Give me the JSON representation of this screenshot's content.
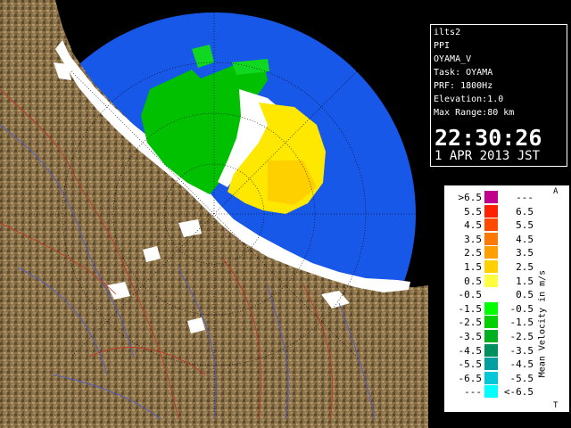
{
  "info": {
    "site": "ilts2",
    "product": "PPI",
    "radar": "OYAMA_V",
    "task": "Task: OYAMA",
    "prf": "PRF: 1800Hz",
    "elevation": "Elevation:1.0",
    "max_range": "Max Range:80 km",
    "time": "22:30:26",
    "date": "1 APR 2013 JST"
  },
  "legend": {
    "title": "Mean Velocity in m/s",
    "corner_top": "A",
    "corner_bottom": "T",
    "rows": [
      {
        "lo": ">6.5",
        "hi": "---",
        "color": "#c0008c"
      },
      {
        "lo": "5.5",
        "hi": "6.5",
        "color": "#ff2000"
      },
      {
        "lo": "4.5",
        "hi": "5.5",
        "color": "#ff4a00"
      },
      {
        "lo": "3.5",
        "hi": "4.5",
        "color": "#ff7800"
      },
      {
        "lo": "2.5",
        "hi": "3.5",
        "color": "#ffa000"
      },
      {
        "lo": "1.5",
        "hi": "2.5",
        "color": "#ffd000"
      },
      {
        "lo": "0.5",
        "hi": "1.5",
        "color": "#ffff40"
      },
      {
        "lo": "-0.5",
        "hi": "0.5",
        "color": "#ffffff"
      },
      {
        "lo": "-1.5",
        "hi": "-0.5",
        "color": "#00ff00"
      },
      {
        "lo": "-2.5",
        "hi": "-1.5",
        "color": "#00d000"
      },
      {
        "lo": "-3.5",
        "hi": "-2.5",
        "color": "#00b020"
      },
      {
        "lo": "-4.5",
        "hi": "-3.5",
        "color": "#009060"
      },
      {
        "lo": "-5.5",
        "hi": "-4.5",
        "color": "#00a0a0"
      },
      {
        "lo": "-6.5",
        "hi": "-5.5",
        "color": "#00c8d8"
      },
      {
        "lo": "---",
        "hi": "<-6.5",
        "color": "#00ffff"
      }
    ]
  },
  "colors": {
    "sea": "#1e60f0",
    "range_ring_fill": "#1858e8",
    "land": "#8a7048",
    "rivers": "#4a5ad8",
    "boundaries": "#c83020"
  }
}
